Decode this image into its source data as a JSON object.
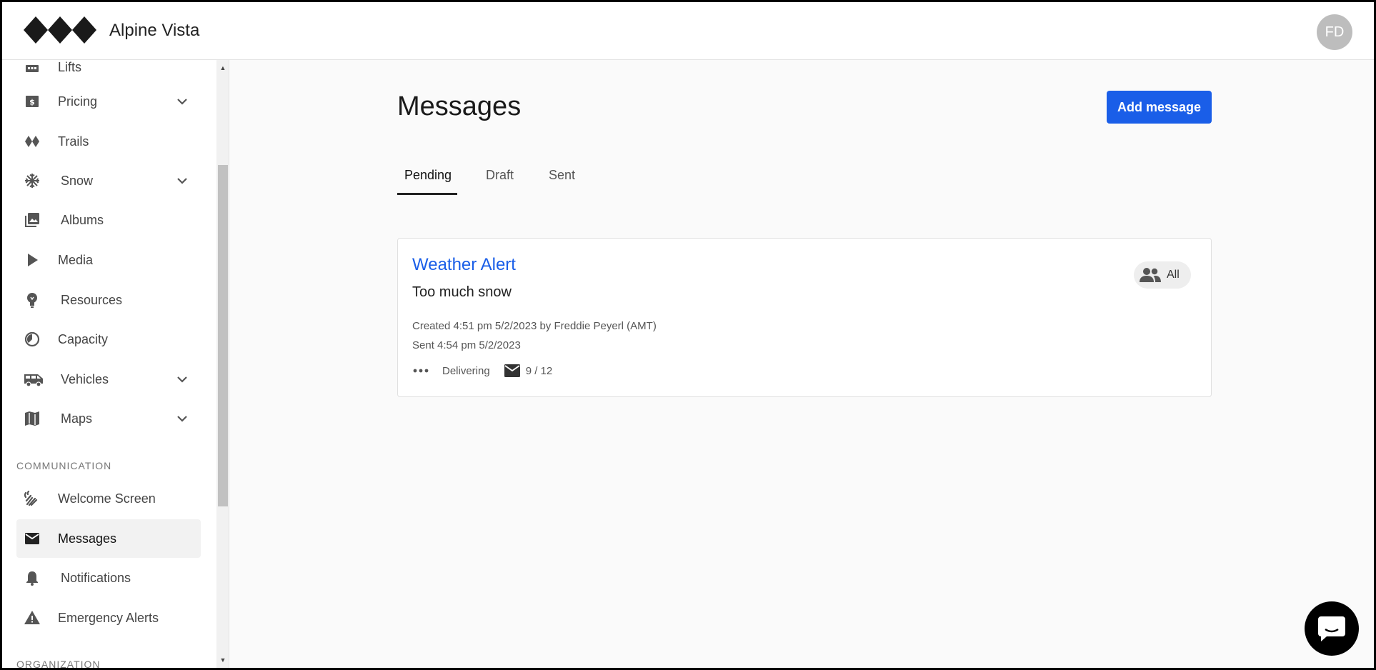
{
  "header": {
    "brand": "Alpine Vista",
    "avatar_initials": "FD"
  },
  "sidebar": {
    "items": [
      {
        "label": "Lifts",
        "icon": "lift-icon"
      },
      {
        "label": "Pricing",
        "icon": "dollar-icon",
        "expandable": true
      },
      {
        "label": "Trails",
        "icon": "trail-icon"
      },
      {
        "label": "Snow",
        "icon": "snowflake-icon",
        "expandable": true
      },
      {
        "label": "Albums",
        "icon": "photo-album-icon"
      },
      {
        "label": "Media",
        "icon": "play-icon"
      },
      {
        "label": "Resources",
        "icon": "lightbulb-icon"
      },
      {
        "label": "Capacity",
        "icon": "gauge-icon"
      },
      {
        "label": "Vehicles",
        "icon": "bus-icon",
        "expandable": true
      },
      {
        "label": "Maps",
        "icon": "map-icon",
        "expandable": true
      }
    ],
    "sections": {
      "communication": "COMMUNICATION",
      "organization": "ORGANIZATION"
    },
    "communication_items": [
      {
        "label": "Welcome Screen",
        "icon": "wave-icon"
      },
      {
        "label": "Messages",
        "icon": "mail-icon",
        "active": true
      },
      {
        "label": "Notifications",
        "icon": "bell-icon"
      },
      {
        "label": "Emergency Alerts",
        "icon": "warning-icon"
      }
    ]
  },
  "main": {
    "title": "Messages",
    "add_button": "Add message",
    "tabs": [
      {
        "label": "Pending",
        "active": true
      },
      {
        "label": "Draft"
      },
      {
        "label": "Sent"
      }
    ],
    "message": {
      "title": "Weather Alert",
      "body": "Too much snow",
      "created": "Created 4:51 pm 5/2/2023 by Freddie Peyerl (AMT)",
      "sent": "Sent 4:54 pm 5/2/2023",
      "status": "Delivering",
      "delivery_count": "9 / 12",
      "audience": "All"
    }
  },
  "colors": {
    "accent": "#1a5ee8",
    "active_bg": "#f2f2f2"
  }
}
